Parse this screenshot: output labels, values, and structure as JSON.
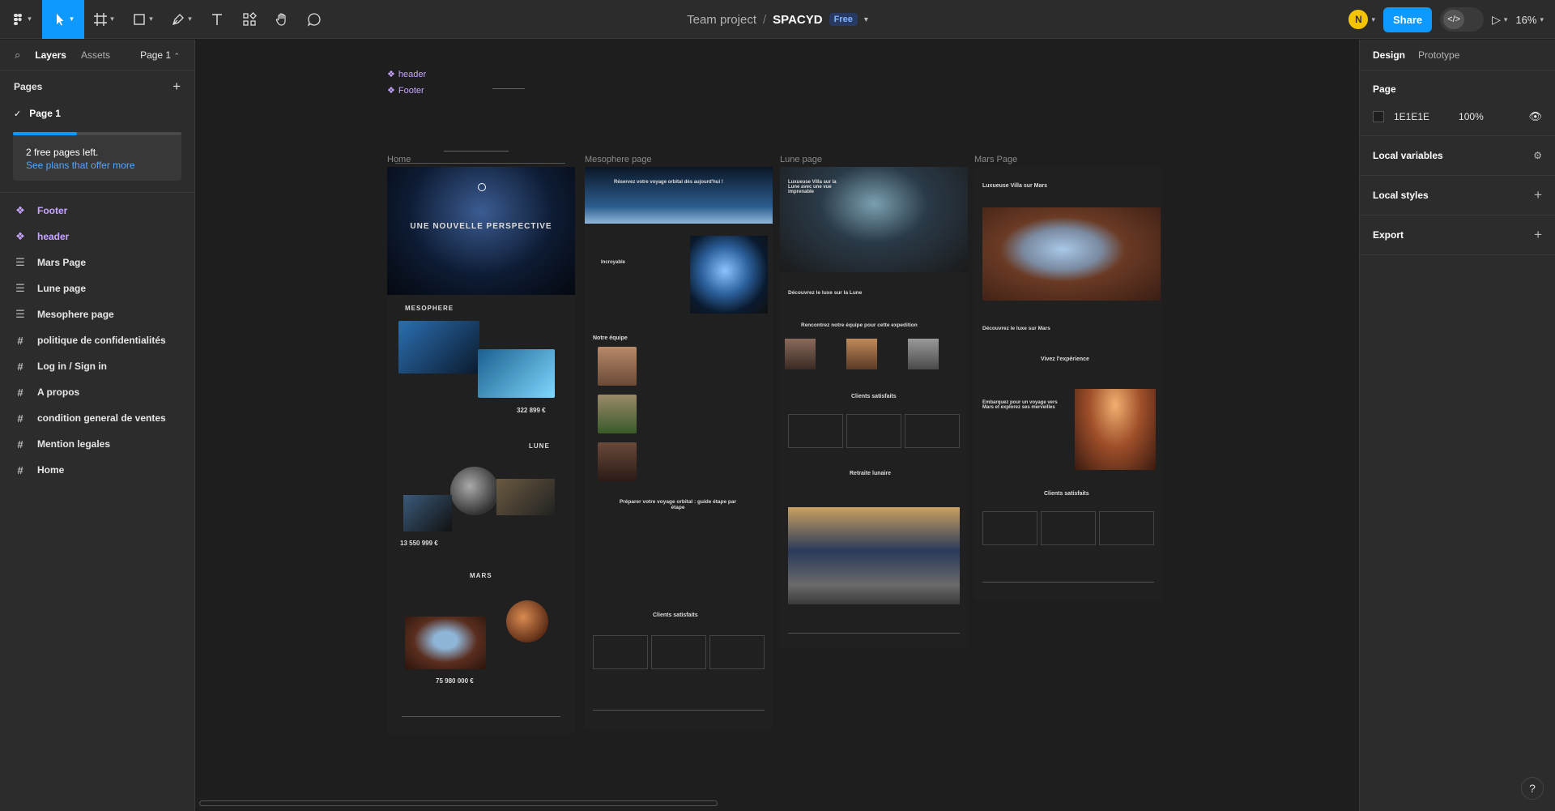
{
  "toolbar": {
    "move_tool": "move-tool",
    "frame_tool": "frame-tool",
    "shape_tool": "rectangle-tool",
    "pen_tool": "pen-tool",
    "text_tool": "text-tool",
    "resources_tool": "resources-tool",
    "hand_tool": "hand-tool",
    "comment_tool": "comment-tool",
    "team": "Team project",
    "separator": "/",
    "project": "SPACYD",
    "plan_badge": "Free",
    "avatar_initial": "N",
    "share_label": "Share",
    "zoom": "16%"
  },
  "left_panel": {
    "tabs": [
      "Layers",
      "Assets"
    ],
    "page_selector": "Page 1",
    "pages_heading": "Pages",
    "pages": [
      "Page 1"
    ],
    "promo_text": "2 free pages left.",
    "promo_link": "See plans that offer more",
    "layers": [
      {
        "label": "Footer",
        "kind": "component"
      },
      {
        "label": "header",
        "kind": "component"
      },
      {
        "label": "Mars Page",
        "kind": "section"
      },
      {
        "label": "Lune page",
        "kind": "section"
      },
      {
        "label": "Mesophere page",
        "kind": "section"
      },
      {
        "label": "politique de confidentialités",
        "kind": "frame"
      },
      {
        "label": "Log in / Sign in",
        "kind": "frame"
      },
      {
        "label": "A propos",
        "kind": "frame"
      },
      {
        "label": "condition general de ventes",
        "kind": "frame"
      },
      {
        "label": "Mention legales",
        "kind": "frame"
      },
      {
        "label": "Home",
        "kind": "frame"
      }
    ]
  },
  "canvas": {
    "component_labels": [
      "header",
      "Footer"
    ],
    "frames": [
      {
        "label": "Home",
        "title": "UNE NOUVELLE PERSPECTIVE",
        "sections": [
          "MESOPHERE",
          "LUNE",
          "MARS"
        ],
        "prices": [
          "322 899 €",
          "13 550 999 €",
          "75 980 000 €"
        ]
      },
      {
        "label": "Mesophere page",
        "hero": "Réservez votre voyage orbital dès aujourd'hui !",
        "sub": "Incroyable",
        "team": "Notre équipe",
        "guide": "Préparer votre voyage orbital : guide étape par étape",
        "reviews": "Clients satisfaits"
      },
      {
        "label": "Lune page",
        "hero": "Luxueuse Villa sur la Lune avec une vue imprenable",
        "sub": "Découvrez le luxe sur la Lune",
        "team": "Rencontrez notre équipe pour cette expedition",
        "reviews": "Clients satisfaits",
        "retreat": "Retraite lunaire"
      },
      {
        "label": "Mars Page",
        "hero": "Luxueuse Villa sur Mars",
        "sub": "Découvrez le luxe sur Mars",
        "exp": "Vivez l'expérience",
        "journey": "Embarquez pour un voyage vers Mars et explorez ses merveilles",
        "reviews": "Clients satisfaits"
      }
    ]
  },
  "right_panel": {
    "tabs": [
      "Design",
      "Prototype"
    ],
    "page_heading": "Page",
    "bg_color": "1E1E1E",
    "opacity": "100%",
    "local_variables": "Local variables",
    "local_styles": "Local styles",
    "export": "Export",
    "help": "?"
  },
  "colors": {
    "accent": "#0d99ff",
    "component": "#c8a6ff",
    "panel": "#2c2c2c",
    "canvas": "#1e1e1e"
  }
}
